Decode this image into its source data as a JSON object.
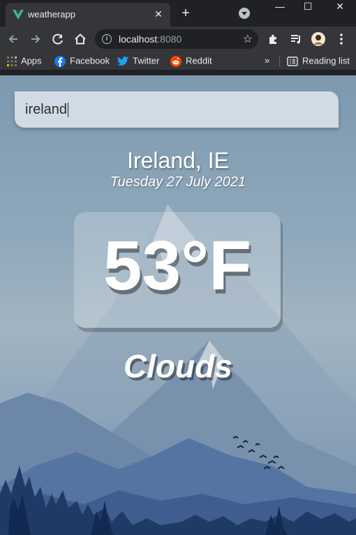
{
  "browser": {
    "tab": {
      "title": "weatherapp",
      "favicon": "vue-logo-icon",
      "accent": "#42b883"
    },
    "address": {
      "host": "localhost",
      "port": ":8080"
    },
    "bookmarks": [
      {
        "label": "Apps",
        "icon": "apps-grid-icon"
      },
      {
        "label": "Facebook",
        "icon": "facebook-icon",
        "color": "#1877f2"
      },
      {
        "label": "Twitter",
        "icon": "twitter-icon",
        "color": "#1da1f2"
      },
      {
        "label": "Reddit",
        "icon": "reddit-icon",
        "color": "#ff4500"
      }
    ],
    "reading_list": "Reading list",
    "overflow": "»"
  },
  "app": {
    "search": {
      "value": "ireland"
    },
    "location": "Ireland, IE",
    "date": "Tuesday 27 July 2021",
    "temperature": "53°F",
    "weather": "Clouds"
  }
}
